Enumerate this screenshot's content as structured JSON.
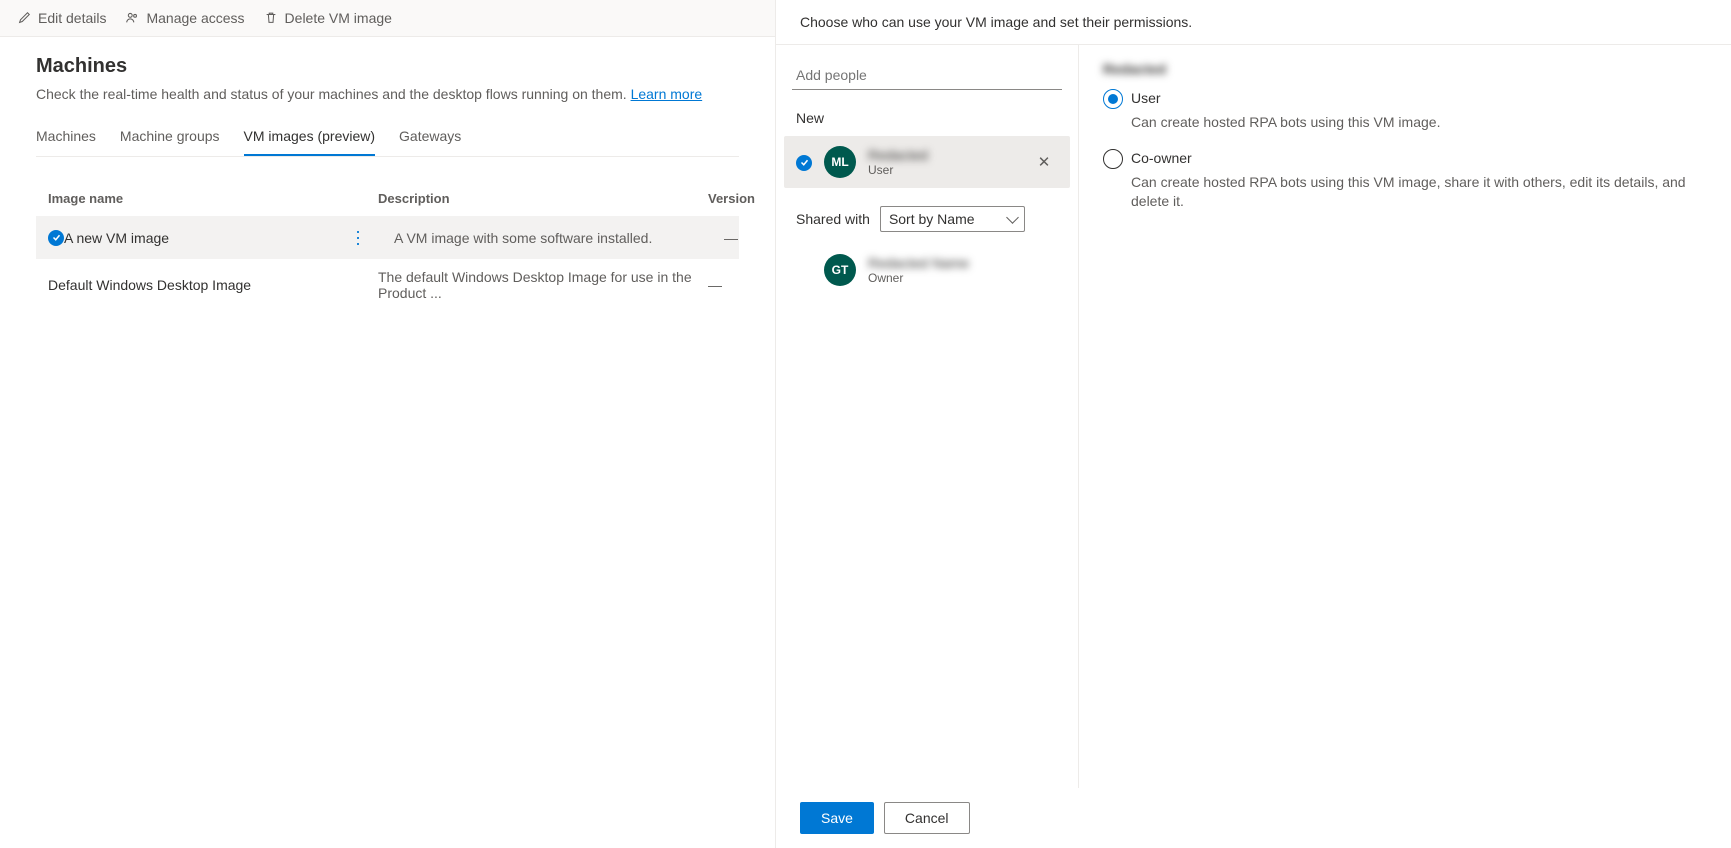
{
  "toolbar": {
    "edit": "Edit details",
    "manage": "Manage access",
    "delete": "Delete VM image"
  },
  "page": {
    "title": "Machines",
    "subtitle_prefix": "Check the real-time health and status of your machines and the desktop flows running on them. ",
    "learn_more": "Learn more"
  },
  "tabs": [
    {
      "label": "Machines",
      "active": false
    },
    {
      "label": "Machine groups",
      "active": false
    },
    {
      "label": "VM images (preview)",
      "active": true
    },
    {
      "label": "Gateways",
      "active": false
    }
  ],
  "table": {
    "headers": {
      "name": "Image name",
      "desc": "Description",
      "version": "Version"
    },
    "rows": [
      {
        "selected": true,
        "name": "A new VM image",
        "desc": "A VM image with some software installed.",
        "version": "—"
      },
      {
        "selected": false,
        "name": "Default Windows Desktop Image",
        "desc": "The default Windows Desktop Image for use in the Product ...",
        "version": "—"
      }
    ]
  },
  "panel": {
    "intro": "Choose who can use your VM image and set their permissions.",
    "add_placeholder": "Add people",
    "new_label": "New",
    "shared_label": "Shared with",
    "sort_option": "Sort by Name",
    "save": "Save",
    "cancel": "Cancel"
  },
  "people": {
    "new": {
      "initials": "ML",
      "name": "Redacted",
      "role": "User"
    },
    "shared": {
      "initials": "GT",
      "name": "Redacted Name",
      "role": "Owner"
    }
  },
  "permissions": {
    "heading": "Redacted",
    "options": [
      {
        "label": "User",
        "desc": "Can create hosted RPA bots using this VM image.",
        "checked": true
      },
      {
        "label": "Co-owner",
        "desc": "Can create hosted RPA bots using this VM image, share it with others, edit its details, and delete it.",
        "checked": false
      }
    ]
  }
}
